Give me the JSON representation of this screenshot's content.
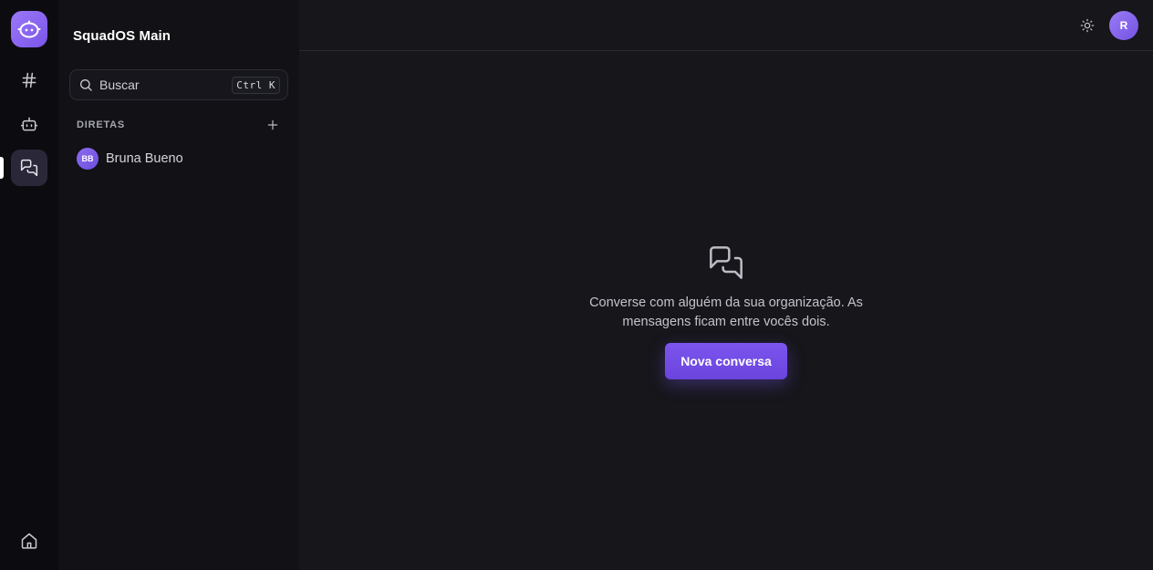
{
  "colors": {
    "accent": "#7c55ee",
    "rail_bg": "#0c0c10",
    "sidebar_bg": "#111116",
    "main_bg": "#16161b"
  },
  "rail": {
    "items": [
      {
        "name": "channels",
        "icon": "hash-icon"
      },
      {
        "name": "bots",
        "icon": "bot-icon"
      },
      {
        "name": "direct-messages",
        "icon": "messages-icon",
        "active": true
      }
    ],
    "bottom": {
      "name": "home",
      "icon": "home-icon"
    }
  },
  "sidebar": {
    "workspace_title": "SquadOS Main",
    "search": {
      "placeholder": "Buscar",
      "shortcut": "Ctrl K"
    },
    "section": {
      "label": "DIRETAS"
    },
    "direct_messages": [
      {
        "initials": "BB",
        "name": "Bruna Bueno"
      }
    ]
  },
  "topbar": {
    "theme_icon": "sun-icon",
    "user_initial": "R"
  },
  "empty_state": {
    "icon": "messages-icon",
    "text": "Converse com alguém da sua organização. As mensagens ficam entre vocês dois.",
    "button_label": "Nova conversa"
  }
}
